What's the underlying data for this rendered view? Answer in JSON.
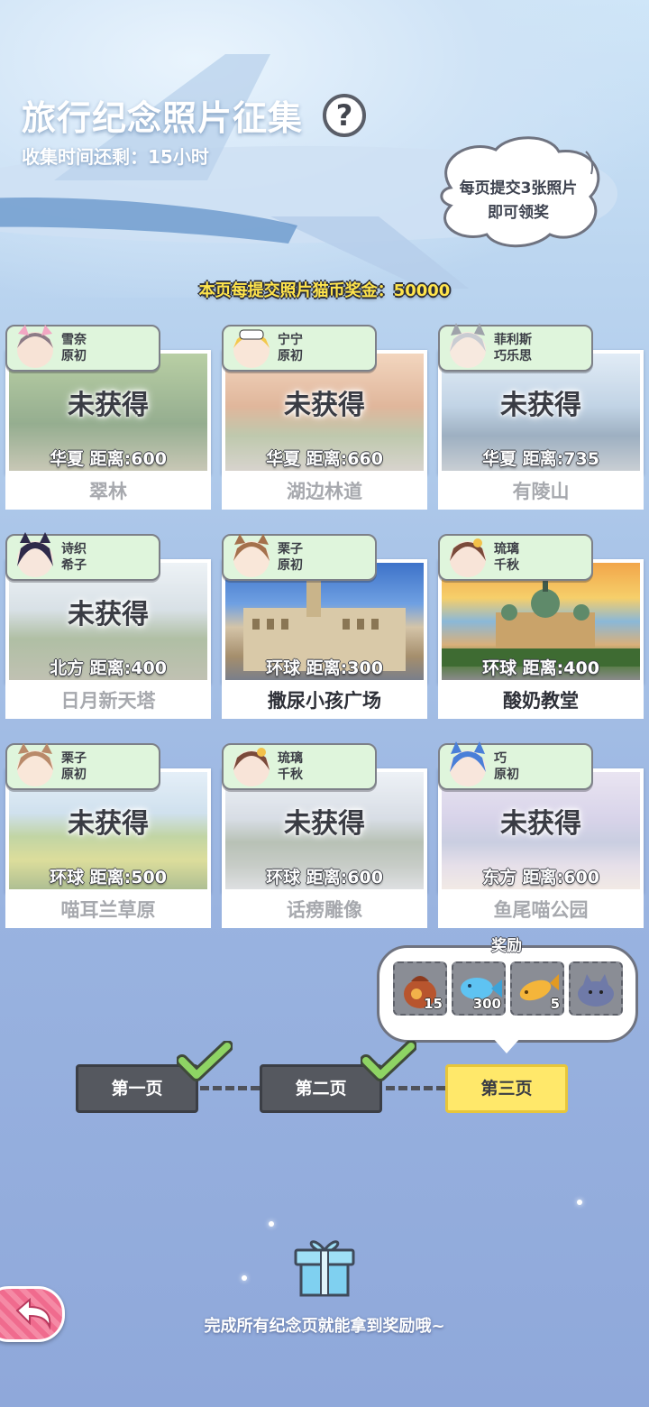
{
  "header": {
    "title": "旅行纪念照片征集",
    "remaining": "收集时间还剩：15小时",
    "help_label": "?",
    "bubble_line1": "每页提交3张照片",
    "bubble_line2": "即可领奖",
    "bonus": "本页每提交照片猫币奖金：50000"
  },
  "cards": [
    {
      "char1": "雪奈",
      "char2": "原初",
      "status": "未获得",
      "distance": "华夏  距离:600",
      "name": "翠林"
    },
    {
      "char1": "宁宁",
      "char2": "原初",
      "status": "未获得",
      "distance": "华夏  距离:660",
      "name": "湖边林道"
    },
    {
      "char1": "菲利斯",
      "char2": "巧乐思",
      "status": "未获得",
      "distance": "华夏  距离:735",
      "name": "有陵山"
    },
    {
      "char1": "诗织",
      "char2": "希子",
      "status": "未获得",
      "distance": "北方  距离:400",
      "name": "日月新天塔"
    },
    {
      "char1": "栗子",
      "char2": "原初",
      "status": "",
      "distance": "环球  距离:300",
      "name": "撒尿小孩广场"
    },
    {
      "char1": "琉璃",
      "char2": "千秋",
      "status": "",
      "distance": "环球  距离:400",
      "name": "酸奶教堂"
    },
    {
      "char1": "栗子",
      "char2": "原初",
      "status": "未获得",
      "distance": "环球  距离:500",
      "name": "喵耳兰草原"
    },
    {
      "char1": "琉璃",
      "char2": "千秋",
      "status": "未获得",
      "distance": "环球  距离:600",
      "name": "话痨雕像"
    },
    {
      "char1": "巧",
      "char2": "原初",
      "status": "未获得",
      "distance": "东方  距离:600",
      "name": "鱼尾喵公园"
    }
  ],
  "reward": {
    "title": "奖励",
    "items": [
      {
        "icon": "coin-bag-icon",
        "count": "15"
      },
      {
        "icon": "blue-fish-icon",
        "count": "300"
      },
      {
        "icon": "golden-fish-icon",
        "count": "5"
      },
      {
        "icon": "cat-plush-icon",
        "count": ""
      }
    ]
  },
  "pages": [
    {
      "label": "第一页",
      "done": true,
      "active": false
    },
    {
      "label": "第二页",
      "done": true,
      "active": false
    },
    {
      "label": "第三页",
      "done": false,
      "active": true
    }
  ],
  "footer": {
    "text": "完成所有纪念页就能拿到奖励哦~"
  },
  "colors": {
    "tag_bg": "#dff5dc",
    "active_page": "#ffe86a",
    "inactive_page": "#55585f",
    "bonus_text": "#ffe44b",
    "back_button": "#f06b8e"
  }
}
